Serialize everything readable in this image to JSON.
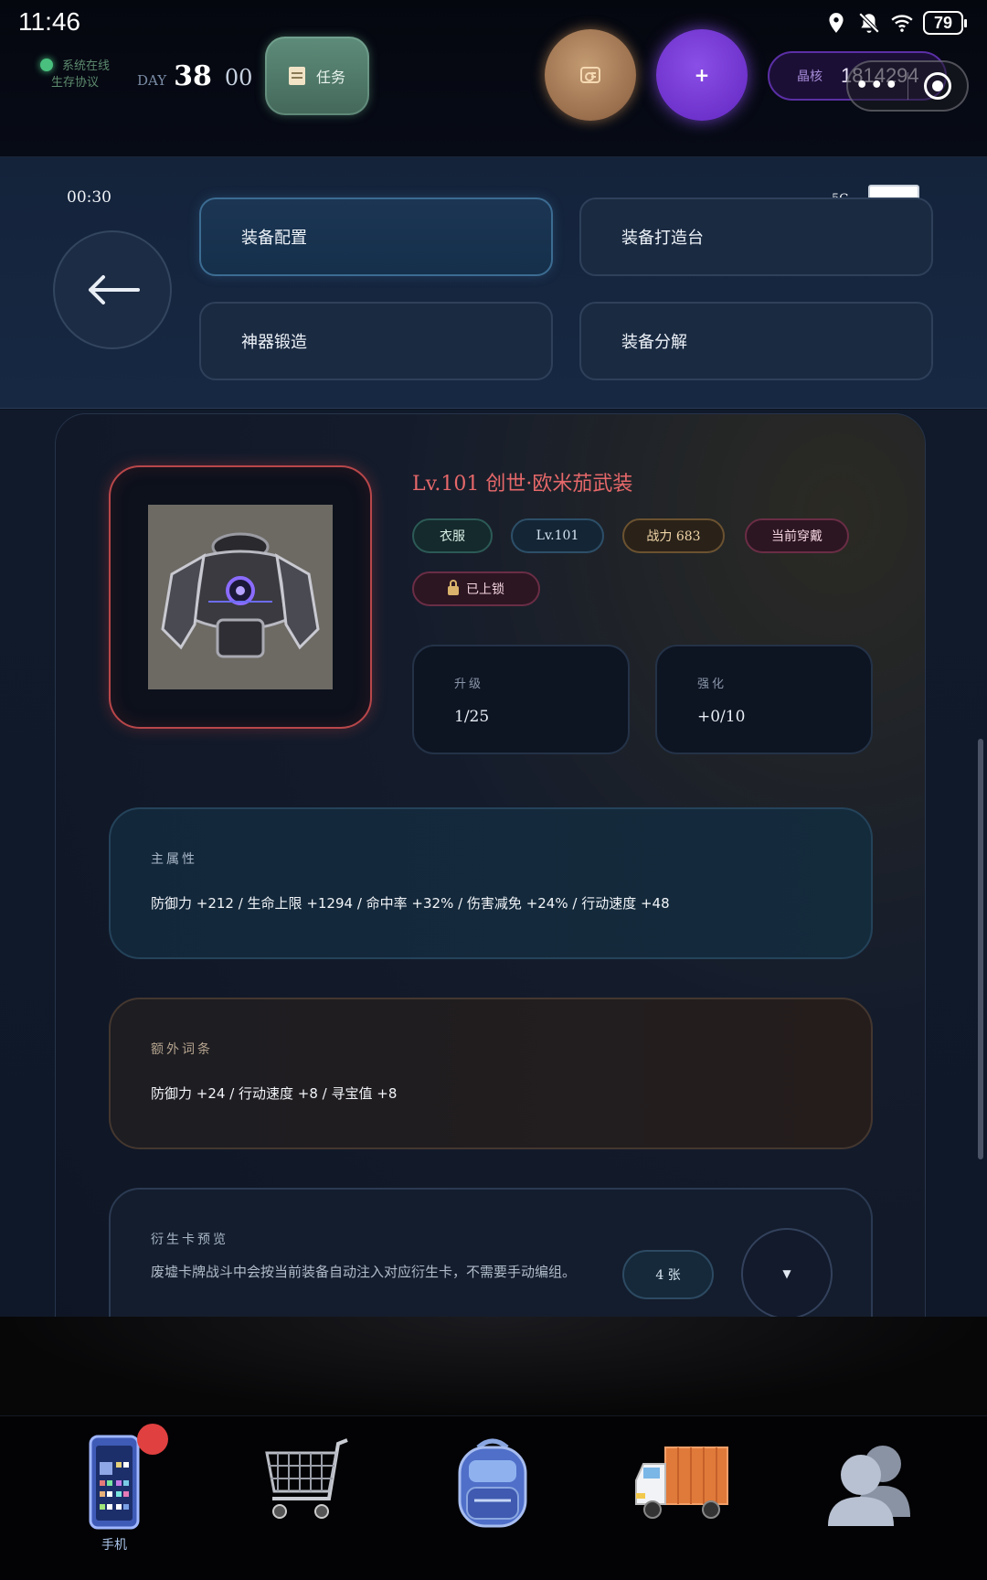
{
  "status_bar": {
    "time": "11:46",
    "battery": "79"
  },
  "hud": {
    "status_line1": "系统在线",
    "status_line2": "生存协议",
    "day_label": "DAY",
    "day_value": "38",
    "day_sub": "00",
    "task_label": "任务",
    "plus_label": "+",
    "crystal_label": "晶核",
    "crystal_value": "1814294",
    "more_label": "•••"
  },
  "nav": {
    "time": "00:30",
    "network": "5G",
    "buttons": [
      {
        "label": "装备配置",
        "active": true
      },
      {
        "label": "装备打造台",
        "active": false
      },
      {
        "label": "神器锻造",
        "active": false
      },
      {
        "label": "装备分解",
        "active": false
      }
    ]
  },
  "item": {
    "title": "Lv.101 创世·欧米茄武装",
    "tags": {
      "slot": "衣服",
      "level": "Lv.101",
      "power": "战力 683",
      "equipped": "当前穿戴",
      "locked": "已上锁"
    },
    "upgrade_label": "升级",
    "upgrade_value": "1/25",
    "enhance_label": "强化",
    "enhance_value": "+0/10"
  },
  "main_attr": {
    "label": "主属性",
    "value": "防御力 +212 / 生命上限 +1294 / 命中率 +32% / 伤害减免 +24% / 行动速度 +48"
  },
  "extra_attr": {
    "label": "额外词条",
    "value": "防御力 +24 / 行动速度 +8 / 寻宝值 +8"
  },
  "derived_cards": {
    "label": "衍生卡预览",
    "desc": "废墟卡牌战斗中会按当前装备自动注入对应衍生卡，不需要手动编组。",
    "count": "4 张",
    "expand_symbol": "▼"
  },
  "dock": {
    "phone_label": "手机"
  },
  "colors": {
    "accent_red": "#e6686a",
    "purple": "#6b2fc9",
    "online_green": "#49c07e"
  }
}
